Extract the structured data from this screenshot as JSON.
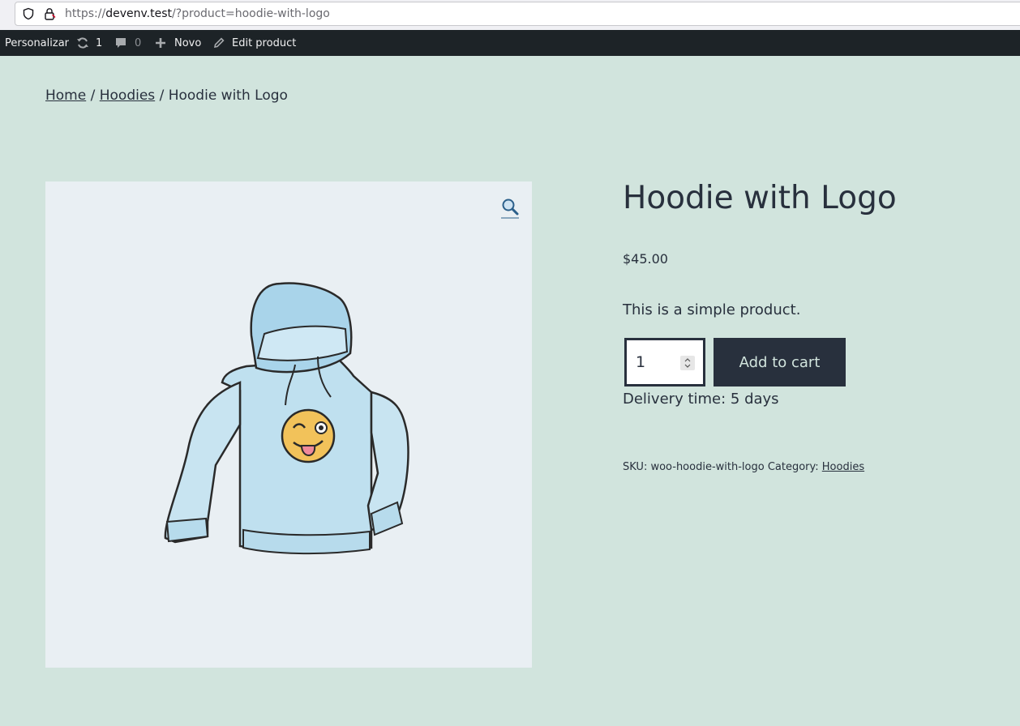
{
  "browser": {
    "url_scheme": "https://",
    "url_host": "devenv.test",
    "url_path": "/?product=hoodie-with-logo"
  },
  "admin_bar": {
    "customize_label": "Personalizar",
    "updates_count": "1",
    "comments_count": "0",
    "new_label": "Novo",
    "edit_label": "Edit product"
  },
  "breadcrumb": {
    "home": "Home",
    "sep1": " / ",
    "category": "Hoodies",
    "sep2": " / ",
    "current": "Hoodie with Logo"
  },
  "product": {
    "title": "Hoodie with Logo",
    "price": "$45.00",
    "short_description": "This is a simple product.",
    "quantity": "1",
    "add_to_cart_label": "Add to cart",
    "delivery": "Delivery time: 5 days",
    "sku_label": "SKU: ",
    "sku": "woo-hoodie-with-logo",
    "category_label": " Category: ",
    "category": "Hoodies"
  },
  "icons": {
    "address_bar": [
      "shield-icon",
      "lock-icon"
    ],
    "admin_bar": [
      "updates-icon",
      "comments-icon",
      "plus-icon",
      "pencil-icon"
    ],
    "gallery": [
      "zoom-icon"
    ]
  },
  "colors": {
    "background": "#d1e4dd",
    "text": "#28303d",
    "admin_bar": "#1d2327",
    "image_bg": "#e9eff3"
  }
}
